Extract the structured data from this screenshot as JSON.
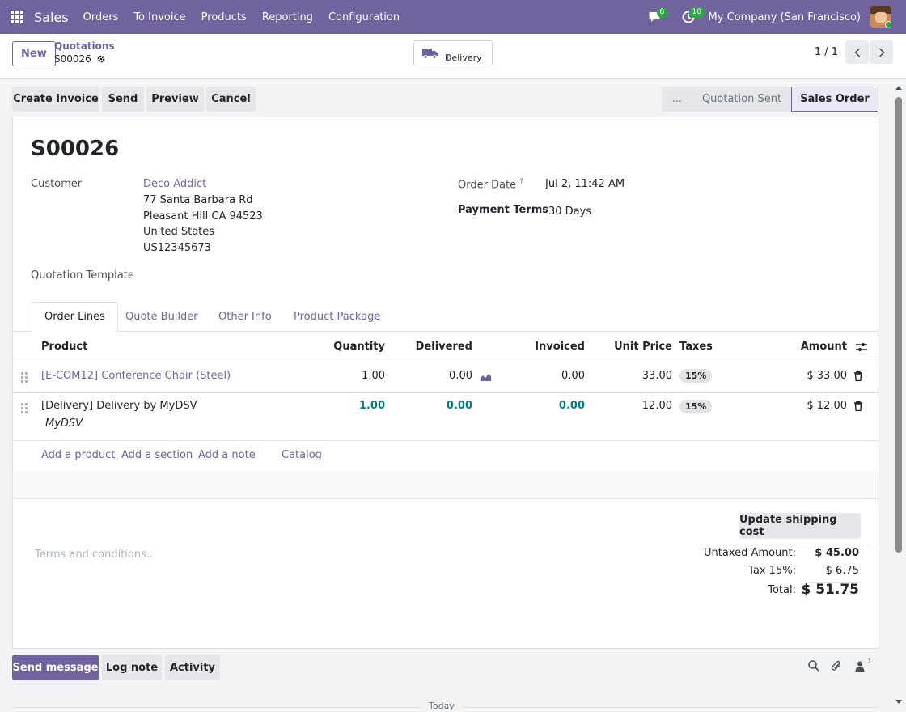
{
  "navbar": {
    "app_name": "Sales",
    "menu": [
      "Orders",
      "To Invoice",
      "Products",
      "Reporting",
      "Configuration"
    ],
    "messages_count": "8",
    "activities_count": "10",
    "company": "My Company (San Francisco)"
  },
  "control_panel": {
    "new_label": "New",
    "breadcrumb_parent": "Quotations",
    "breadcrumb_current": "S00026",
    "delivery_label": "Delivery",
    "delivery_count": "1",
    "pager": "1 / 1"
  },
  "actions": {
    "create_invoice": "Create Invoice",
    "send": "Send",
    "preview": "Preview",
    "cancel": "Cancel"
  },
  "statusbar": {
    "more": "...",
    "stages": [
      "Quotation Sent",
      "Sales Order"
    ],
    "active": "Sales Order"
  },
  "form": {
    "title": "S00026",
    "customer_label": "Customer",
    "customer_name": "Deco Addict",
    "address": [
      "77 Santa Barbara Rd",
      "Pleasant Hill CA 94523",
      "United States",
      "US12345673"
    ],
    "order_date_label": "Order Date",
    "order_date_help": "?",
    "order_date": "Jul 2, 11:42 AM",
    "payment_terms_label": "Payment Terms",
    "payment_terms": "30 Days",
    "template_label": "Quotation Template"
  },
  "tabs": [
    "Order Lines",
    "Quote Builder",
    "Other Info",
    "Product Package"
  ],
  "table": {
    "headers": {
      "product": "Product",
      "quantity": "Quantity",
      "delivered": "Delivered",
      "invoiced": "Invoiced",
      "unit_price": "Unit Price",
      "taxes": "Taxes",
      "amount": "Amount"
    },
    "rows": [
      {
        "product": "[E-COM12] Conference Chair (Steel)",
        "quantity": "1.00",
        "delivered": "0.00",
        "invoiced": "0.00",
        "unit_price": "33.00",
        "tax": "15%",
        "amount": "$ 33.00"
      },
      {
        "product": "[Delivery] Delivery by MyDSV",
        "note": "MyDSV",
        "quantity": "1.00",
        "delivered": "0.00",
        "invoiced": "0.00",
        "unit_price": "12.00",
        "tax": "15%",
        "amount": "$ 12.00"
      }
    ],
    "add_product": "Add a product",
    "add_section": "Add a section",
    "add_note": "Add a note",
    "catalog": "Catalog"
  },
  "footer": {
    "update_shipping": "Update shipping cost",
    "terms_placeholder": "Terms and conditions...",
    "untaxed_label": "Untaxed Amount:",
    "untaxed_value": "$ 45.00",
    "tax_label": "Tax 15%:",
    "tax_value": "$ 6.75",
    "total_label": "Total:",
    "total_value": "$ 51.75"
  },
  "chatter": {
    "send_message": "Send message",
    "log_note": "Log note",
    "activity": "Activity",
    "followers_count": "1",
    "date_separator": "Today"
  }
}
